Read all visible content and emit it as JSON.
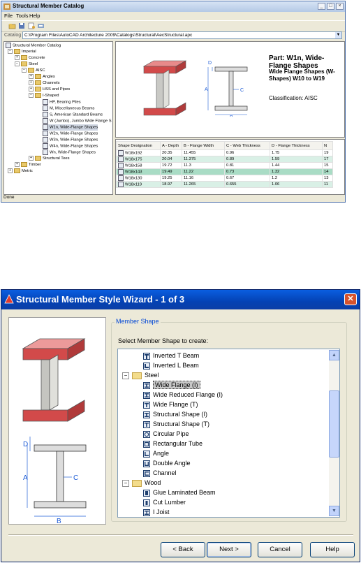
{
  "catalog": {
    "title": "Structural Member Catalog",
    "menu": [
      "File",
      "Tools",
      "Help"
    ],
    "catalog_label": "Catalog",
    "catalog_path": "C:\\Program Files\\AutoCAD Architecture 2009\\Catalogs\\Structural\\AecStructural.apc",
    "tree": {
      "root": "Structural Member Catalog",
      "imperial": "Imperial",
      "concrete": "Concrete",
      "steel": "Steel",
      "aisc": "AISC",
      "angles": "Angles",
      "channels": "Channels",
      "hss": "HSS and Pipes",
      "ishaped": "I-Shaped",
      "ishaped_items": [
        "HP, Bearing Piles",
        "M, Miscellaneous Beams",
        "S, American Standard Beams",
        "W (Jumbo), Jumbo Wide Flange S",
        "W1n, Wide-Flange Shapes",
        "W2n, Wide-Flange Shapes",
        "W3n, Wide-Flange Shapes",
        "W4n, Wide-Flange Shapes",
        "Wn, Wide-Flange Shapes"
      ],
      "structural_tees": "Structural Tees",
      "timber": "Timber",
      "metric": "Metric"
    },
    "preview": {
      "part": "Part: W1n, Wide-Flange Shapes",
      "subtitle": "Wide Flange Shapes (W-Shapes) W10 to W19",
      "classification": "Classification: AISC",
      "dims": {
        "a": "A",
        "b": "B",
        "c": "C",
        "d": "D"
      }
    },
    "grid": {
      "columns": [
        "Shape Designation",
        "A - Depth",
        "B - Flange Width",
        "C - Web Thickness",
        "D - Flange Thickness",
        "N"
      ],
      "rows": [
        [
          "W18x192",
          "20.35",
          "11.455",
          "0.96",
          "1.75",
          "19"
        ],
        [
          "W18x175",
          "20.04",
          "11.375",
          "0.89",
          "1.59",
          "17"
        ],
        [
          "W18x158",
          "19.72",
          "11.3",
          "0.81",
          "1.44",
          "15"
        ],
        [
          "W18x143",
          "19.49",
          "11.22",
          "0.73",
          "1.32",
          "14"
        ],
        [
          "W18x130",
          "19.25",
          "11.16",
          "0.67",
          "1.2",
          "13"
        ],
        [
          "W18x119",
          "18.97",
          "11.265",
          "0.655",
          "1.06",
          "11"
        ]
      ]
    },
    "status": "Done"
  },
  "wizard": {
    "title": "Structural Member Style Wizard - 1 of 3",
    "group_label": "Member Shape",
    "select_label": "Select Member Shape to create:",
    "dims": {
      "a": "A",
      "b": "B",
      "c": "C",
      "d": "D"
    },
    "tree": {
      "concrete_items": [
        "Inverted T Beam",
        "Inverted L Beam"
      ],
      "steel": "Steel",
      "steel_items": [
        "Wide Flange (I)",
        "Wide Reduced Flange (I)",
        "Wide Flange (T)",
        "Structural Shape (I)",
        "Structural Shape (T)",
        "Circular Pipe",
        "Rectangular Tube",
        "Angle",
        "Double Angle",
        "Channel"
      ],
      "wood": "Wood",
      "wood_items": [
        "Glue Laminated Beam",
        "Cut Lumber",
        "I Joist"
      ]
    },
    "buttons": {
      "back": "< Back",
      "next": "Next >",
      "cancel": "Cancel",
      "help": "Help"
    }
  },
  "colors": {
    "flange_red": "#d24a4a",
    "xp_title_blue": "#0a5ee0",
    "grid_highlight": "#a9dcc5"
  }
}
